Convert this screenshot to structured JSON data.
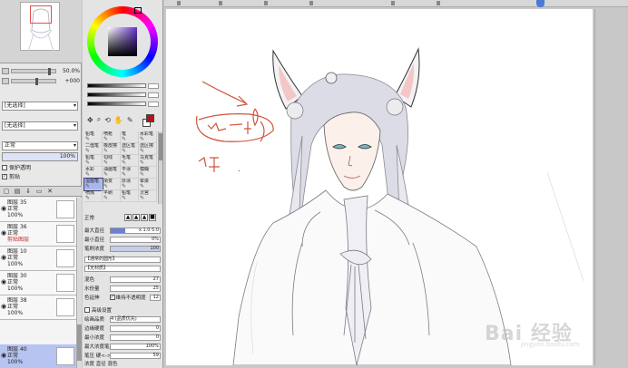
{
  "navigator": {
    "zoom_value": "50.0%",
    "angle_value": "+000"
  },
  "left_panel": {
    "selection_source_1": "[无选择]",
    "selection_source_2": "[无选择]",
    "mode_label": "正常",
    "opacity_value": "100%",
    "check_protect": "保护透明",
    "check_clip": "剪贴",
    "check_clip_checked": "✓"
  },
  "layers": [
    {
      "kind": "图层",
      "num": "35",
      "mode": "正常",
      "opacity": "100%",
      "extra": ""
    },
    {
      "kind": "图层",
      "num": "36",
      "mode": "正常",
      "opacity": "",
      "extra": "剪贴图层"
    },
    {
      "kind": "图层",
      "num": "10",
      "mode": "正常",
      "opacity": "100%",
      "extra": ""
    },
    {
      "kind": "图层",
      "num": "30",
      "mode": "正常",
      "opacity": "100%",
      "extra": ""
    },
    {
      "kind": "图层",
      "num": "38",
      "mode": "正常",
      "opacity": "100%",
      "extra": ""
    },
    {
      "kind": "图层",
      "num": "40",
      "mode": "正常",
      "opacity": "100%",
      "extra": ""
    }
  ],
  "tools": [
    {
      "label": "铅笔",
      "icon": "pencil-icon"
    },
    {
      "label": "喷枪",
      "icon": "airbrush-icon"
    },
    {
      "label": "笔",
      "icon": "pen-icon"
    },
    {
      "label": "水彩笔",
      "icon": "watercolor-icon"
    },
    {
      "label": "二值笔",
      "icon": "binary-pen-icon"
    },
    {
      "label": "橡皮擦",
      "icon": "eraser-icon"
    },
    {
      "label": "选区笔",
      "icon": "select-pen-icon"
    },
    {
      "label": "选区擦",
      "icon": "select-eraser-icon"
    },
    {
      "label": "铅笔",
      "icon": "pencil-icon"
    },
    {
      "label": "勾线",
      "icon": "line-icon"
    },
    {
      "label": "毛笔",
      "icon": "brush-icon"
    },
    {
      "label": "马克笔",
      "icon": "marker-icon"
    },
    {
      "label": "水彩",
      "icon": "water-icon"
    },
    {
      "label": "油画笔",
      "icon": "oil-icon"
    },
    {
      "label": "平涂",
      "icon": "flat-icon"
    },
    {
      "label": "模糊",
      "icon": "blur-icon"
    },
    {
      "label": "湿画笔",
      "icon": "wet-icon"
    },
    {
      "label": "渐变",
      "icon": "gradient-icon"
    },
    {
      "label": "厚涂",
      "icon": "impasto-icon"
    },
    {
      "label": "晕染",
      "icon": "blend-icon"
    },
    {
      "label": "喷溅",
      "icon": "splash-icon"
    },
    {
      "label": "平刷",
      "icon": "flat-brush-icon"
    },
    {
      "label": "铅笔",
      "icon": "pencil-icon"
    },
    {
      "label": "灵宫",
      "icon": "misc-icon"
    }
  ],
  "brush_settings": {
    "blend_mode": "正常",
    "max_size_label": "最大直径",
    "max_size_value": "x 1.0  5.0",
    "min_size_label": "最小直径",
    "min_size_value": "0%",
    "density_label": "笔刷浓度",
    "density_value": "100",
    "shape_label": "【通常的圆形】",
    "texture_label": "【无材质】",
    "mix_label": "混色",
    "mix_value": "27",
    "water_label": "水份量",
    "water_value": "25",
    "keep_label": "色延伸",
    "keep_value": "12",
    "keep_opacity_check": "维持不透明度",
    "advanced_label": "高级设置",
    "quality_label": "绘画品质",
    "quality_value": "4 (品质优先)",
    "edge_label": "边缘硬度",
    "edge_value": "0",
    "min_density_label": "最小浓度",
    "min_density_value": "0",
    "max_density_label": "最大浓度笔压",
    "max_density_value": "100%",
    "pressure_label": "笔压 硬<->软",
    "pressure_value": "59",
    "pressure_opts": "浓度 直径 混色"
  },
  "canvas": {
    "watermark": "Bai 经验",
    "watermark_sub": "jingyan.baidu.com"
  },
  "colors": {
    "fg_color": "#b0151c",
    "accent_select": "#b7c3f0",
    "sketch_red": "#d0533b"
  }
}
